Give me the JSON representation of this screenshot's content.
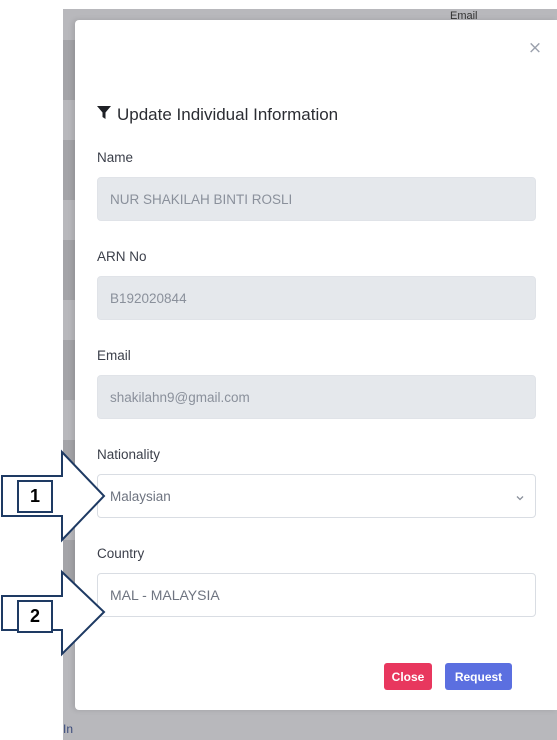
{
  "background": {
    "right_header_text": "Email",
    "bottom_text": "In"
  },
  "modal": {
    "title": "Update Individual Information",
    "close_icon": "close-icon",
    "title_icon": "filter-icon",
    "fields": {
      "name": {
        "label": "Name",
        "value": "NUR SHAKILAH BINTI ROSLI"
      },
      "arn": {
        "label": "ARN No",
        "value": "B192020844"
      },
      "email": {
        "label": "Email",
        "value": "shakilahn9@gmail.com"
      },
      "nationality": {
        "label": "Nationality",
        "value": "Malaysian"
      },
      "country": {
        "label": "Country",
        "value": "MAL - MALAYSIA"
      }
    },
    "buttons": {
      "close": "Close",
      "request": "Request"
    }
  },
  "annotations": {
    "one": "1",
    "two": "2"
  },
  "colors": {
    "close_button": "#e8375e",
    "request_button": "#5b6fe0",
    "annotation_border": "#1e3a63"
  }
}
